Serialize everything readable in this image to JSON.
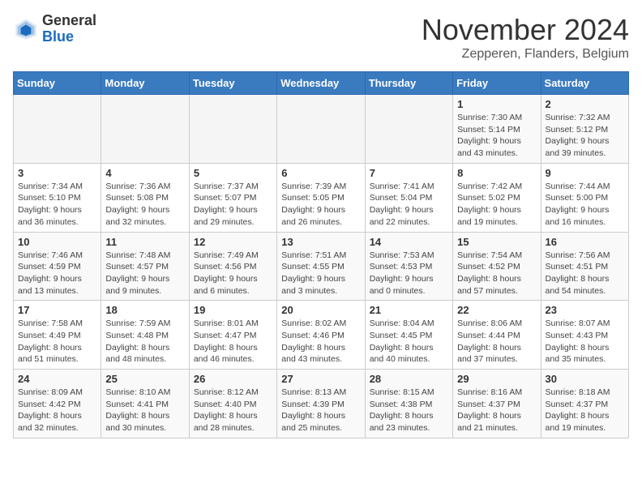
{
  "logo": {
    "general": "General",
    "blue": "Blue"
  },
  "title": "November 2024",
  "location": "Zepperen, Flanders, Belgium",
  "days_of_week": [
    "Sunday",
    "Monday",
    "Tuesday",
    "Wednesday",
    "Thursday",
    "Friday",
    "Saturday"
  ],
  "weeks": [
    [
      {
        "day": "",
        "info": ""
      },
      {
        "day": "",
        "info": ""
      },
      {
        "day": "",
        "info": ""
      },
      {
        "day": "",
        "info": ""
      },
      {
        "day": "",
        "info": ""
      },
      {
        "day": "1",
        "info": "Sunrise: 7:30 AM\nSunset: 5:14 PM\nDaylight: 9 hours\nand 43 minutes."
      },
      {
        "day": "2",
        "info": "Sunrise: 7:32 AM\nSunset: 5:12 PM\nDaylight: 9 hours\nand 39 minutes."
      }
    ],
    [
      {
        "day": "3",
        "info": "Sunrise: 7:34 AM\nSunset: 5:10 PM\nDaylight: 9 hours\nand 36 minutes."
      },
      {
        "day": "4",
        "info": "Sunrise: 7:36 AM\nSunset: 5:08 PM\nDaylight: 9 hours\nand 32 minutes."
      },
      {
        "day": "5",
        "info": "Sunrise: 7:37 AM\nSunset: 5:07 PM\nDaylight: 9 hours\nand 29 minutes."
      },
      {
        "day": "6",
        "info": "Sunrise: 7:39 AM\nSunset: 5:05 PM\nDaylight: 9 hours\nand 26 minutes."
      },
      {
        "day": "7",
        "info": "Sunrise: 7:41 AM\nSunset: 5:04 PM\nDaylight: 9 hours\nand 22 minutes."
      },
      {
        "day": "8",
        "info": "Sunrise: 7:42 AM\nSunset: 5:02 PM\nDaylight: 9 hours\nand 19 minutes."
      },
      {
        "day": "9",
        "info": "Sunrise: 7:44 AM\nSunset: 5:00 PM\nDaylight: 9 hours\nand 16 minutes."
      }
    ],
    [
      {
        "day": "10",
        "info": "Sunrise: 7:46 AM\nSunset: 4:59 PM\nDaylight: 9 hours\nand 13 minutes."
      },
      {
        "day": "11",
        "info": "Sunrise: 7:48 AM\nSunset: 4:57 PM\nDaylight: 9 hours\nand 9 minutes."
      },
      {
        "day": "12",
        "info": "Sunrise: 7:49 AM\nSunset: 4:56 PM\nDaylight: 9 hours\nand 6 minutes."
      },
      {
        "day": "13",
        "info": "Sunrise: 7:51 AM\nSunset: 4:55 PM\nDaylight: 9 hours\nand 3 minutes."
      },
      {
        "day": "14",
        "info": "Sunrise: 7:53 AM\nSunset: 4:53 PM\nDaylight: 9 hours\nand 0 minutes."
      },
      {
        "day": "15",
        "info": "Sunrise: 7:54 AM\nSunset: 4:52 PM\nDaylight: 8 hours\nand 57 minutes."
      },
      {
        "day": "16",
        "info": "Sunrise: 7:56 AM\nSunset: 4:51 PM\nDaylight: 8 hours\nand 54 minutes."
      }
    ],
    [
      {
        "day": "17",
        "info": "Sunrise: 7:58 AM\nSunset: 4:49 PM\nDaylight: 8 hours\nand 51 minutes."
      },
      {
        "day": "18",
        "info": "Sunrise: 7:59 AM\nSunset: 4:48 PM\nDaylight: 8 hours\nand 48 minutes."
      },
      {
        "day": "19",
        "info": "Sunrise: 8:01 AM\nSunset: 4:47 PM\nDaylight: 8 hours\nand 46 minutes."
      },
      {
        "day": "20",
        "info": "Sunrise: 8:02 AM\nSunset: 4:46 PM\nDaylight: 8 hours\nand 43 minutes."
      },
      {
        "day": "21",
        "info": "Sunrise: 8:04 AM\nSunset: 4:45 PM\nDaylight: 8 hours\nand 40 minutes."
      },
      {
        "day": "22",
        "info": "Sunrise: 8:06 AM\nSunset: 4:44 PM\nDaylight: 8 hours\nand 37 minutes."
      },
      {
        "day": "23",
        "info": "Sunrise: 8:07 AM\nSunset: 4:43 PM\nDaylight: 8 hours\nand 35 minutes."
      }
    ],
    [
      {
        "day": "24",
        "info": "Sunrise: 8:09 AM\nSunset: 4:42 PM\nDaylight: 8 hours\nand 32 minutes."
      },
      {
        "day": "25",
        "info": "Sunrise: 8:10 AM\nSunset: 4:41 PM\nDaylight: 8 hours\nand 30 minutes."
      },
      {
        "day": "26",
        "info": "Sunrise: 8:12 AM\nSunset: 4:40 PM\nDaylight: 8 hours\nand 28 minutes."
      },
      {
        "day": "27",
        "info": "Sunrise: 8:13 AM\nSunset: 4:39 PM\nDaylight: 8 hours\nand 25 minutes."
      },
      {
        "day": "28",
        "info": "Sunrise: 8:15 AM\nSunset: 4:38 PM\nDaylight: 8 hours\nand 23 minutes."
      },
      {
        "day": "29",
        "info": "Sunrise: 8:16 AM\nSunset: 4:37 PM\nDaylight: 8 hours\nand 21 minutes."
      },
      {
        "day": "30",
        "info": "Sunrise: 8:18 AM\nSunset: 4:37 PM\nDaylight: 8 hours\nand 19 minutes."
      }
    ]
  ]
}
